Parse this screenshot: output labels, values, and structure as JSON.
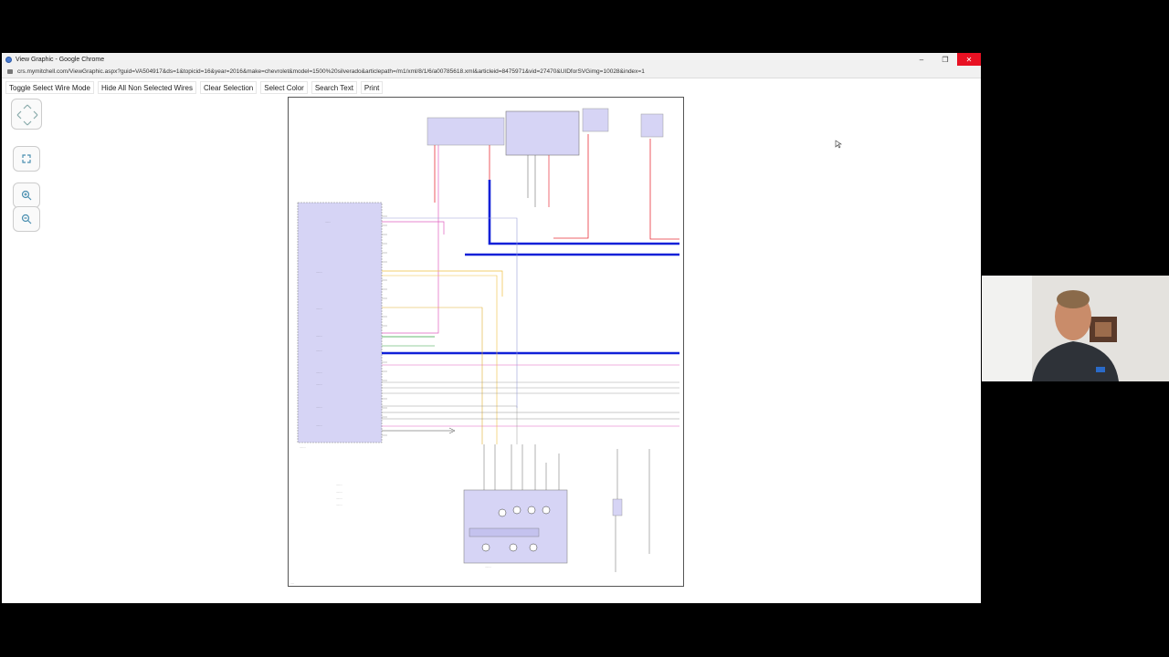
{
  "window": {
    "title": "View Graphic - Google Chrome",
    "url": "crs.mymitchell.com/ViewGraphic.aspx?guid=VA504917&ds=1&topicid=16&year=2016&make=chevrolet&model=1500%20silverado&articlepath=/m1/xml/8/1/6/a00785618.xml&articleid=8475971&vid=27470&UIDforSVGimg=10028&index=1",
    "controls": {
      "minimize": "–",
      "restore": "❐",
      "close": "✕"
    }
  },
  "toolbar": {
    "buttons": [
      {
        "label": "Toggle Select Wire Mode"
      },
      {
        "label": "Hide All Non Selected Wires"
      },
      {
        "label": "Clear Selection"
      },
      {
        "label": "Select Color"
      },
      {
        "label": "Search Text"
      },
      {
        "label": "Print"
      }
    ]
  },
  "icons": {
    "pan": "pan-arrows-icon",
    "fit": "fit-to-screen-icon",
    "zoom_in": "zoom-in-icon",
    "zoom_out": "zoom-out-icon"
  },
  "colors": {
    "highlight_wire": "#1020d8",
    "module_fill": "#d6d4f5",
    "red_wire": "#e8303a",
    "pink_wire": "#e060c0",
    "yellow_wire": "#f0c040",
    "green_wire": "#30a040",
    "close_button": "#e81123"
  }
}
